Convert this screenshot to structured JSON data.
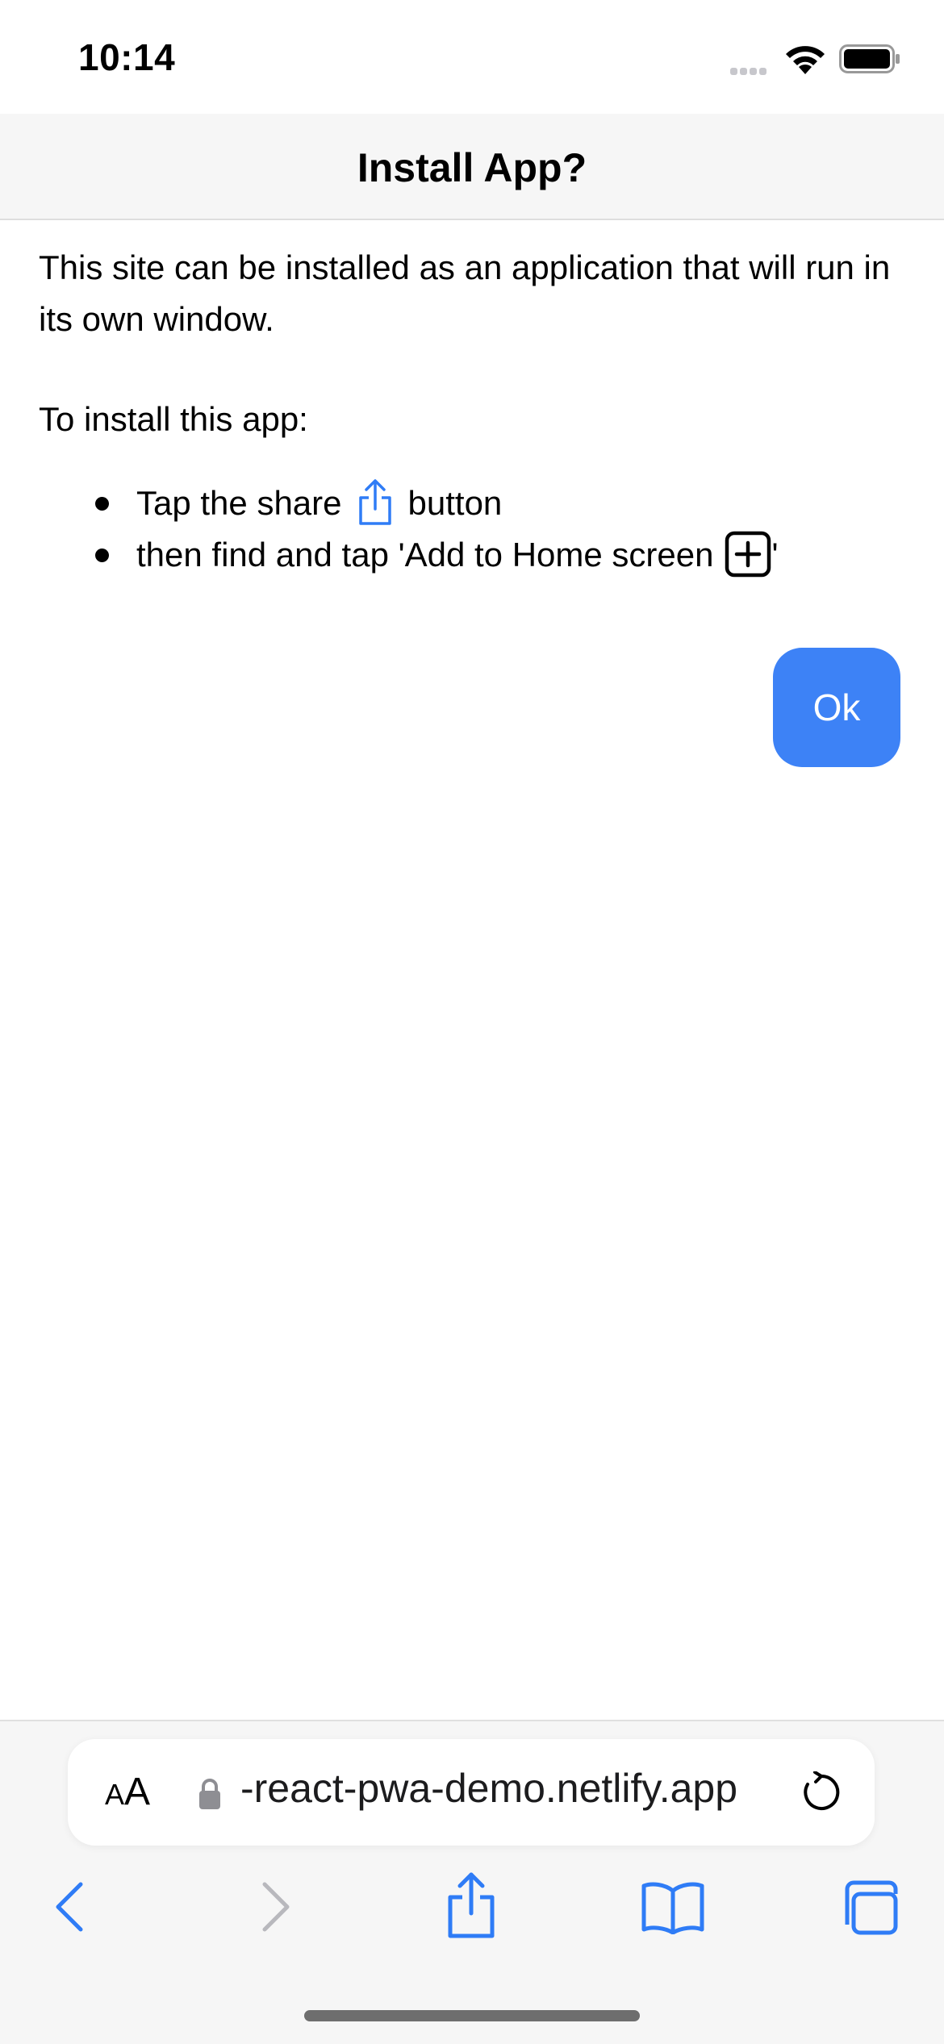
{
  "status_bar": {
    "time": "10:14"
  },
  "dialog": {
    "title": "Install App?",
    "description": "This site can be installed as an application that will run in its own window.",
    "instructions_heading": "To install this app:",
    "step1_before": "Tap the share",
    "step1_after": "button",
    "step2_before": "then find and tap 'Add to Home screen",
    "step2_after": "'",
    "ok_label": "Ok"
  },
  "browser": {
    "aa_big": "A",
    "aa_small": "A",
    "url": "-react-pwa-demo.netlify.app"
  },
  "colors": {
    "accent": "#3d82f6",
    "safari_blue": "#2f7cf6"
  },
  "icons": [
    "wifi-icon",
    "battery-icon",
    "share-icon",
    "add-square-icon",
    "lock-icon",
    "reload-icon",
    "back-chevron-icon",
    "forward-chevron-icon",
    "bookmarks-icon",
    "tabs-icon"
  ]
}
